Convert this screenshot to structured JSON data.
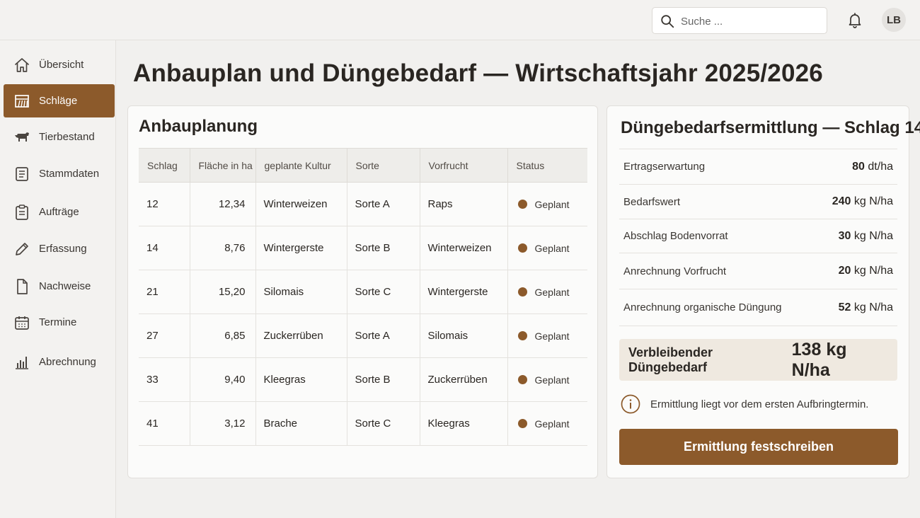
{
  "header": {
    "search_placeholder": "Suche ...",
    "avatar_initials": "LB"
  },
  "sidebar": {
    "items": [
      {
        "label": "Übersicht",
        "icon": "home-icon",
        "active": false
      },
      {
        "label": "Schläge",
        "icon": "field-icon",
        "active": true
      },
      {
        "label": "Tierbestand",
        "icon": "cow-icon",
        "active": false
      },
      {
        "label": "Stammdaten",
        "icon": "document-list-icon",
        "active": false
      },
      {
        "label": "Aufträge",
        "icon": "clipboard-icon",
        "active": false
      },
      {
        "label": "Erfassung",
        "icon": "pencil-icon",
        "active": false
      },
      {
        "label": "Nachweise",
        "icon": "file-icon",
        "active": false
      },
      {
        "label": "Termine",
        "icon": "calendar-icon",
        "active": false
      },
      {
        "label": "Abrechnung",
        "icon": "bar-chart-icon",
        "active": false
      }
    ]
  },
  "page": {
    "title": "Anbauplan und Düngebedarf — Wirtschaftsjahr 2025/2026"
  },
  "planning": {
    "title": "Anbauplanung",
    "columns": [
      "Schlag",
      "Fläche in ha",
      "geplante Kultur",
      "Sorte",
      "Vorfrucht",
      "Status"
    ],
    "rows": [
      {
        "schlag": "12",
        "flaeche": "12,34",
        "kultur": "Winterweizen",
        "sorte": "Sorte A",
        "vorfrucht": "Raps",
        "status": "Geplant"
      },
      {
        "schlag": "14",
        "flaeche": "8,76",
        "kultur": "Wintergerste",
        "sorte": "Sorte B",
        "vorfrucht": "Winterweizen",
        "status": "Geplant"
      },
      {
        "schlag": "21",
        "flaeche": "15,20",
        "kultur": "Silomais",
        "sorte": "Sorte C",
        "vorfrucht": "Wintergerste",
        "status": "Geplant"
      },
      {
        "schlag": "27",
        "flaeche": "6,85",
        "kultur": "Zuckerrüben",
        "sorte": "Sorte A",
        "vorfrucht": "Silomais",
        "status": "Geplant"
      },
      {
        "schlag": "33",
        "flaeche": "9,40",
        "kultur": "Kleegras",
        "sorte": "Sorte B",
        "vorfrucht": "Zuckerrüben",
        "status": "Geplant"
      },
      {
        "schlag": "41",
        "flaeche": "3,12",
        "kultur": "Brache",
        "sorte": "Sorte C",
        "vorfrucht": "Kleegras",
        "status": "Geplant"
      }
    ],
    "status_color": "#8c5a2b"
  },
  "fertilizer": {
    "title": "Düngebedarfsermittlung — Schlag 14",
    "items": [
      {
        "label": "Ertragserwartung",
        "value": "80",
        "unit": "dt/ha"
      },
      {
        "label": "Bedarfswert",
        "value": "240",
        "unit": "kg N/ha"
      },
      {
        "label": "Abschlag Bodenvorrat",
        "value": "30",
        "unit": "kg N/ha"
      },
      {
        "label": "Anrechnung Vorfrucht",
        "value": "20",
        "unit": "kg N/ha"
      },
      {
        "label": "Anrechnung organische Düngung",
        "value": "52",
        "unit": "kg N/ha"
      }
    ],
    "result_label": "Verbleibender Düngebedarf",
    "result_value": "138 kg N/ha",
    "info_text": "Ermittlung liegt vor dem ersten Aufbringtermin.",
    "button_label": "Ermittlung festschreiben"
  },
  "colors": {
    "accent": "#8c5a2b",
    "background": "#f1f0ee",
    "result_background": "#efe9e0"
  }
}
